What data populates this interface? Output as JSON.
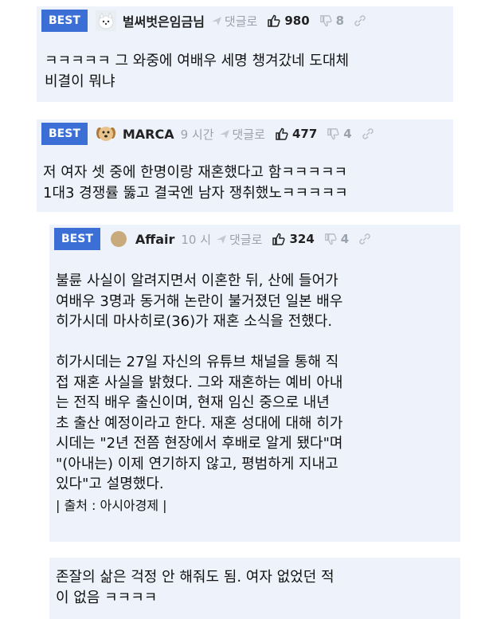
{
  "comments": [
    {
      "badge": "BEST",
      "author": "벌써벗은임금님",
      "time": "",
      "reply_label": "댓글로",
      "upvotes": "980",
      "downvotes": "8",
      "avatar_icon": "white-dog-avatar",
      "text": "ㅋㅋㅋㅋㅋ 그 와중에 여배우 세명 챙겨갔네 도대체\n비결이 뭐냐"
    },
    {
      "badge": "BEST",
      "author": "MARCA",
      "time": "9 시간",
      "reply_label": "댓글로",
      "upvotes": "477",
      "downvotes": "4",
      "avatar_icon": "puppy-avatar",
      "text": "저 여자 셋 중에 한명이랑 재혼했다고 함ㅋㅋㅋㅋㅋ\n1대3 경쟁률 뚫고 결국엔 남자 쟁취했노ㅋㅋㅋㅋㅋ"
    },
    {
      "badge": "BEST",
      "author": "Affair",
      "time": "10 시",
      "reply_label": "댓글로",
      "upvotes": "324",
      "downvotes": "4",
      "avatar_icon": "round-avatar",
      "text": "불륜 사실이 알려지면서 이혼한 뒤, 산에 들어가\n여배우 3명과 동거해 논란이 불거졌던 일본 배우\n히가시데 마사히로(36)가 재혼 소식을 전했다.\n\n히가시데는 27일 자신의 유튜브 채널을 통해 직\n접 재혼 사실을 밝혔다. 그와 재혼하는 예비 아내\n는 전직 배우 출신이며, 현재 임신 중으로 내년\n초 출산 예정이라고 한다. 재혼 성대에 대해 히가\n시데는 \"2년 전쯤 현장에서 후배로 알게 됐다\"며\n\"(아내는) 이제 연기하지 않고, 평범하게 지내고\n있다\"고 설명했다.",
      "source": "| 출처 : 아시아경제 |"
    },
    {
      "text": "존잘의 삶은 걱정 안 해줘도 됨. 여자 없었던 적\n이 없음 ㅋㅋㅋㅋ"
    }
  ],
  "colors": {
    "card_bg": "#eef3fb",
    "badge_bg": "#3b6fd6",
    "meta_gray": "#9aa3ad"
  }
}
